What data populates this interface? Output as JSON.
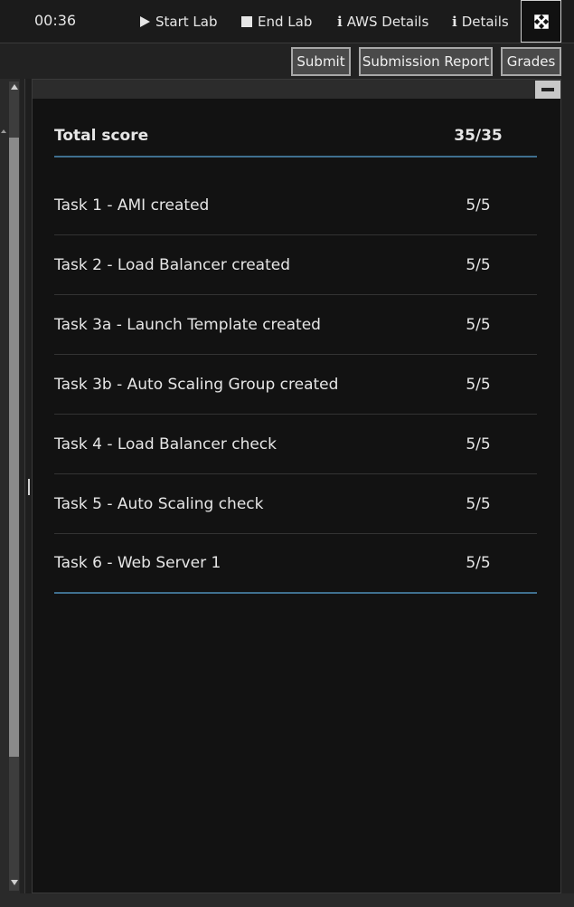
{
  "toolbar": {
    "timer": "00:36",
    "start_lab": "Start Lab",
    "end_lab": "End Lab",
    "aws_details": "AWS Details",
    "details": "Details",
    "info_glyph": "i",
    "icons": {
      "start": "play-icon",
      "end": "stop-icon",
      "info": "info-icon",
      "fullscreen": "expand-icon"
    }
  },
  "actions": {
    "submit": "Submit",
    "submission_report": "Submission Report",
    "grades": "Grades"
  },
  "grades": {
    "total_label": "Total score",
    "total_score": "35/35",
    "tasks": [
      {
        "name": "Task 1 - AMI created",
        "score": "5/5"
      },
      {
        "name": "Task 2 - Load Balancer created",
        "score": "5/5"
      },
      {
        "name": "Task 3a - Launch Template created",
        "score": "5/5"
      },
      {
        "name": "Task 3b - Auto Scaling Group created",
        "score": "5/5"
      },
      {
        "name": "Task 4 - Load Balancer check",
        "score": "5/5"
      },
      {
        "name": "Task 5 - Auto Scaling check",
        "score": "5/5"
      },
      {
        "name": "Task 6 - Web Server 1",
        "score": "5/5"
      }
    ]
  },
  "colors": {
    "background": "#121212",
    "divider_accent": "#3f6f8f",
    "text": "#e6e6e6"
  }
}
